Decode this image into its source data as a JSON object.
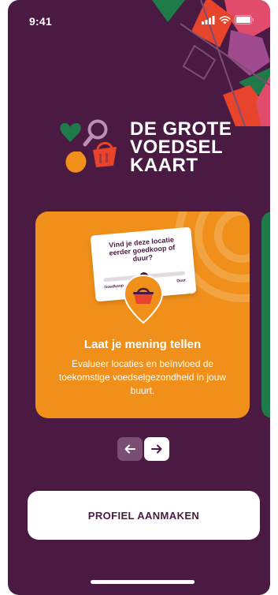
{
  "status_bar": {
    "time": "9:41",
    "icons": [
      "signal-icon",
      "wifi-icon",
      "battery-icon"
    ]
  },
  "logo": {
    "line1": "DE GROTE",
    "line2": "VOEDSEL",
    "line3": "KAART"
  },
  "card": {
    "illustration_question": "Vind je deze locatie eerder goedkoop of duur?",
    "illustration_left": "Goedkoop",
    "illustration_right": "Duur",
    "title": "Laat je mening tellen",
    "description": "Evalueer locaties en beïnvloed de toekomstige voedselgezondheid in jouw buurt."
  },
  "navigation": {
    "prev_icon": "arrow-left-icon",
    "next_icon": "arrow-right-icon"
  },
  "cta": {
    "label": "PROFIEL AANMAKEN"
  },
  "colors": {
    "background": "#4a1a43",
    "card": "#f0901a",
    "accent_green": "#1f7a4a",
    "accent_red": "#e8442b",
    "accent_pink": "#e14b6c",
    "white": "#ffffff"
  }
}
